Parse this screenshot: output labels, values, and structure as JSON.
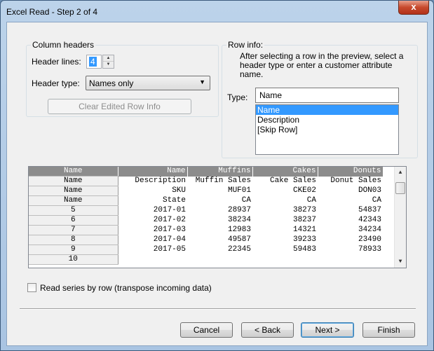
{
  "window": {
    "title": "Excel Read - Step 2 of 4",
    "close_glyph": "x"
  },
  "column_headers": {
    "group_label": "Column headers",
    "header_lines_label": "Header lines:",
    "header_lines_value": "4",
    "header_type_label": "Header type:",
    "header_type_value": "Names only",
    "clear_button": "Clear Edited Row Info"
  },
  "row_info": {
    "group_label": "Row info:",
    "instructions": "After selecting a row in the preview, select a header type or enter a customer attribute name.",
    "type_label": "Type:",
    "type_value": "Name",
    "options": [
      "Name",
      "Description",
      "[Skip Row]"
    ],
    "selected_index": 0
  },
  "preview": {
    "header_row": [
      "Name",
      "Name",
      "Muffins",
      "Cakes",
      "Donuts"
    ],
    "rows": [
      [
        "Name",
        "Description",
        "Muffin Sales",
        "Cake Sales",
        "Donut Sales"
      ],
      [
        "Name",
        "SKU",
        "MUF01",
        "CKE02",
        "DON03"
      ],
      [
        "Name",
        "State",
        "CA",
        "CA",
        "CA"
      ],
      [
        "5",
        "2017-01",
        "28937",
        "38273",
        "54837"
      ],
      [
        "6",
        "2017-02",
        "38234",
        "38237",
        "42343"
      ],
      [
        "7",
        "2017-03",
        "12983",
        "14321",
        "34234"
      ],
      [
        "8",
        "2017-04",
        "49587",
        "39233",
        "23490"
      ],
      [
        "9",
        "2017-05",
        "22345",
        "59483",
        "78933"
      ],
      [
        "10",
        "",
        "",
        "",
        ""
      ]
    ]
  },
  "transpose": {
    "label": "Read series by row (transpose incoming data)",
    "checked": false
  },
  "buttons": {
    "cancel": "Cancel",
    "back": "< Back",
    "next": "Next >",
    "finish": "Finish"
  }
}
